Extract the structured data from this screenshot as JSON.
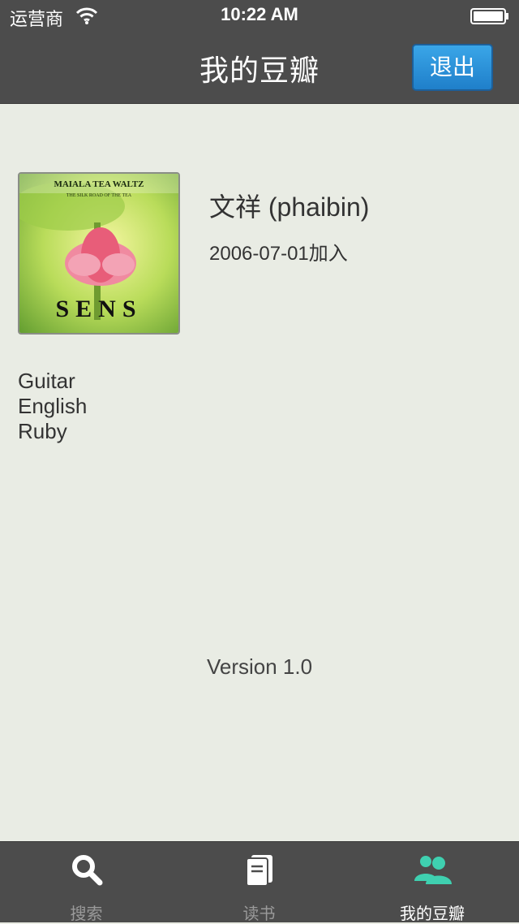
{
  "status_bar": {
    "carrier": "运营商",
    "time": "10:22 AM",
    "wifi_icon": "wifi-icon",
    "battery_icon": "battery-icon"
  },
  "nav": {
    "title": "我的豆瓣",
    "logout_label": "退出"
  },
  "profile": {
    "avatar_icon": "album-cover-avatar",
    "name": "文祥 (phaibin)",
    "joined": "2006-07-01加入",
    "tags": [
      "Guitar",
      "English",
      "Ruby"
    ]
  },
  "footer": {
    "version": "Version 1.0"
  },
  "tabbar": {
    "items": [
      {
        "label": "搜索",
        "icon": "search-icon",
        "active": false
      },
      {
        "label": "读书",
        "icon": "book-icon",
        "active": false
      },
      {
        "label": "我的豆瓣",
        "icon": "people-icon",
        "active": true
      }
    ]
  },
  "colors": {
    "bar_background": "#4c4c4c",
    "content_background": "#e9ece4",
    "button_blue": "#2a8fd9",
    "active_tab_icon": "#3fd0b0"
  }
}
